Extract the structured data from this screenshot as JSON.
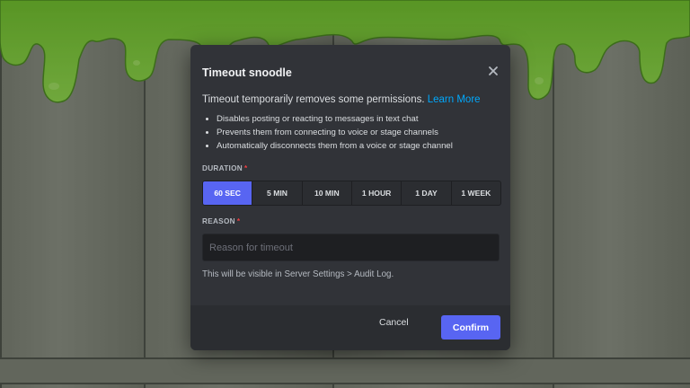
{
  "modal": {
    "title": "Timeout snoodle",
    "close_icon": "close-icon",
    "description": "Timeout temporarily removes some permissions.",
    "learn_more": "Learn More",
    "bullets": [
      "Disables posting or reacting to messages in text chat",
      "Prevents them from connecting to voice or stage channels",
      "Automatically disconnects them from a voice or stage channel"
    ],
    "duration_label": "DURATION",
    "required_mark": "*",
    "durations": [
      "60 SEC",
      "5 MIN",
      "10 MIN",
      "1 HOUR",
      "1 DAY",
      "1 WEEK"
    ],
    "selected_duration": "60 SEC",
    "reason_label": "REASON",
    "reason_placeholder": "Reason for timeout",
    "reason_value": "",
    "note": "This will be visible in Server Settings > Audit Log.",
    "cancel_label": "Cancel",
    "confirm_label": "Confirm"
  },
  "colors": {
    "accent": "#5865f2",
    "link": "#00a8fc",
    "required": "#f23f43",
    "modal_bg": "#313338",
    "footer_bg": "#2b2d31",
    "slime": "#7ec832"
  }
}
